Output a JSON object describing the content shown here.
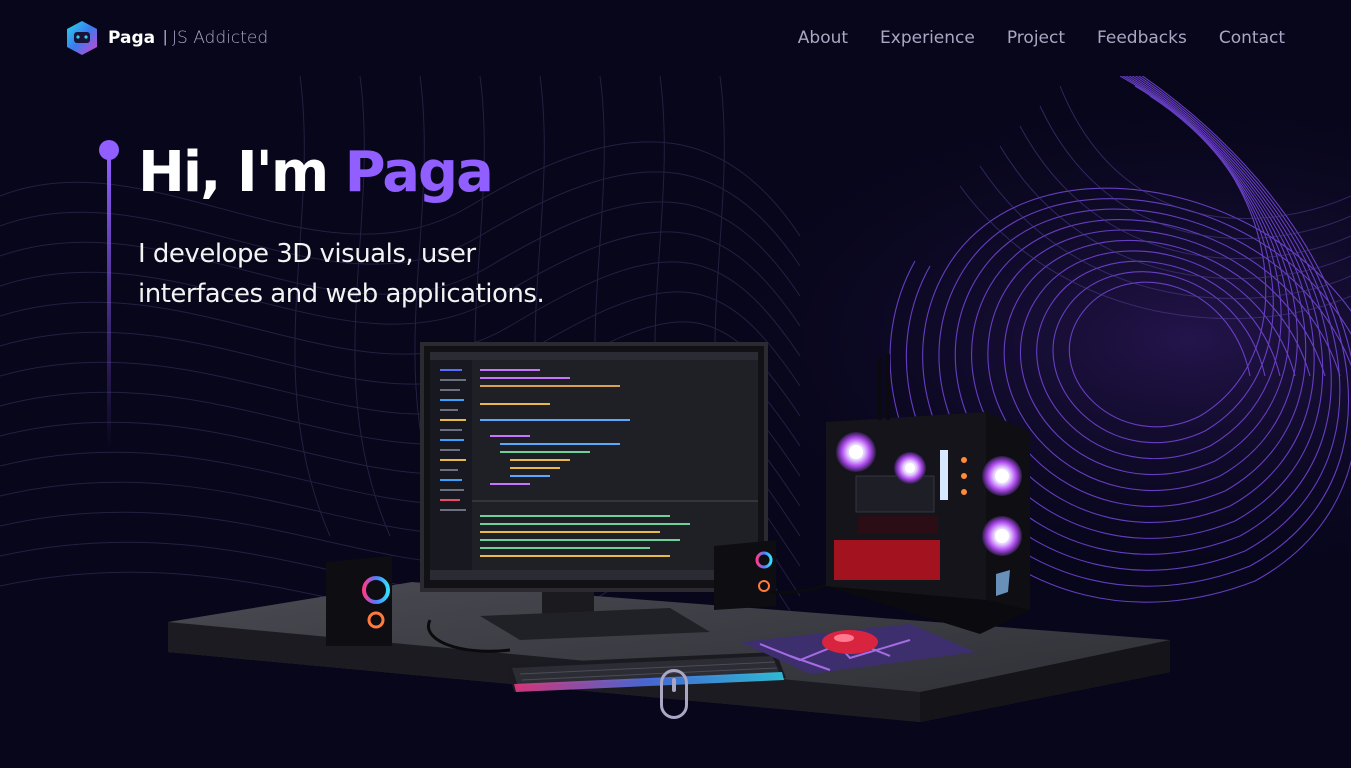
{
  "brand": {
    "name": "Paga",
    "separator": "|",
    "tagline": "JS Addicted"
  },
  "nav": {
    "links": [
      "About",
      "Experience",
      "Project",
      "Feedbacks",
      "Contact"
    ]
  },
  "hero": {
    "greeting": "Hi, I'm",
    "name": "Paga",
    "subtitle_line1": "I develope 3D visuals, user",
    "subtitle_line2": "interfaces and web applications."
  },
  "colors": {
    "background": "#07061a",
    "accent": "#915eff",
    "nav_text": "#aaa6c3"
  },
  "icons": [
    "logo-icon",
    "mouse-scroll-icon"
  ]
}
